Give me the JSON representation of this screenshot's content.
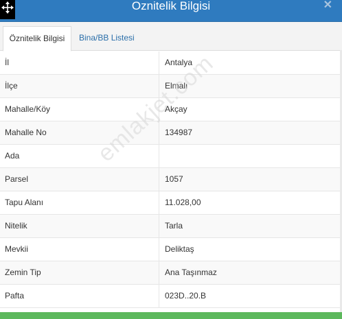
{
  "window": {
    "title": "Oznitelik Bilgisi"
  },
  "tabs": [
    {
      "label": "Öznitelik Bilgisi",
      "active": true
    },
    {
      "label": "Bina/BB Listesi",
      "active": false
    }
  ],
  "rows": [
    {
      "label": "İl",
      "value": "Antalya"
    },
    {
      "label": "İlçe",
      "value": "Elmalı"
    },
    {
      "label": "Mahalle/Köy",
      "value": "Akçay"
    },
    {
      "label": "Mahalle No",
      "value": "134987"
    },
    {
      "label": "Ada",
      "value": ""
    },
    {
      "label": "Parsel",
      "value": "1057"
    },
    {
      "label": "Tapu Alanı",
      "value": "11.028,00"
    },
    {
      "label": "Nitelik",
      "value": "Tarla"
    },
    {
      "label": "Mevkii",
      "value": "Deliktaş"
    },
    {
      "label": "Zemin Tip",
      "value": "Ana Taşınmaz"
    },
    {
      "label": "Pafta",
      "value": "023D..20.B"
    }
  ],
  "watermark": "emlakjet.com",
  "icons": {
    "move": "move-icon",
    "close": "close-icon"
  },
  "colors": {
    "titlebar": "#2f7bbf",
    "tab_link": "#2a6ea9",
    "bottom_bar": "#5cb85c"
  }
}
